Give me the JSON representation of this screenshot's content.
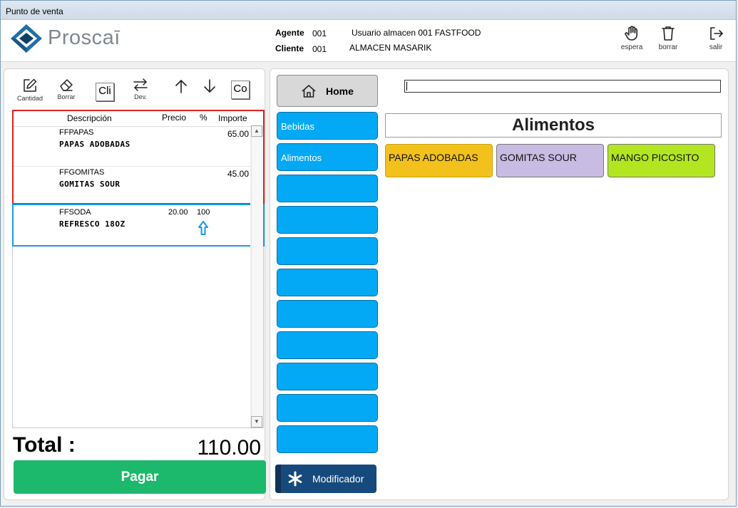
{
  "window": {
    "title": "Punto de venta"
  },
  "header": {
    "logo_text": "Proscaī",
    "agente_label": "Agente",
    "agente_code": "001",
    "agente_name": "Usuario almacen 001 FASTFOOD",
    "cliente_label": "Cliente",
    "cliente_code": "001",
    "cliente_name": "ALMACEN MASARIK",
    "actions": [
      {
        "label": "espera",
        "icon": "hand-icon"
      },
      {
        "label": "borrar",
        "icon": "trash-icon"
      },
      {
        "label": "salir",
        "icon": "logout-icon"
      }
    ]
  },
  "toolbar": {
    "cantidad_label": "Cantidad",
    "borrar_label": "Borrar",
    "cli_label": "Cli",
    "dev_label": "Dev.",
    "co_label": "Co"
  },
  "grid": {
    "columns": {
      "descripcion": "Descripción",
      "precio": "Precio",
      "pct": "%",
      "importe": "Importe"
    },
    "rows": [
      {
        "code": "FFPAPAS",
        "name": "PAPAS ADOBADAS",
        "precio": "",
        "pct": "",
        "importe": "65.00"
      },
      {
        "code": "FFGOMITAS",
        "name": "GOMITAS SOUR",
        "precio": "",
        "pct": "",
        "importe": "45.00"
      },
      {
        "code": "FFSODA",
        "name": "REFRESCO 18OZ",
        "precio": "20.00",
        "pct": "100",
        "importe": ""
      }
    ]
  },
  "total": {
    "label": "Total :",
    "value": "110.00"
  },
  "pay_label": "Pagar",
  "nav": {
    "home_label": "Home",
    "categories": [
      "Bebidas",
      "Alimentos",
      "",
      "",
      "",
      "",
      "",
      "",
      "",
      "",
      ""
    ],
    "modificador_label": "Modificador"
  },
  "search": {
    "value": ""
  },
  "category_title": "Alimentos",
  "products": [
    {
      "name": "PAPAS ADOBADAS",
      "color": "#f2c11c"
    },
    {
      "name": "GOMITAS SOUR",
      "color": "#c8bce3"
    },
    {
      "name": "MANGO PICOSITO",
      "color": "#b3e620"
    }
  ],
  "colors": {
    "accent_blue": "#03a9f4",
    "pay_green": "#1cb86b",
    "highlight_red": "#e02020",
    "highlight_blue": "#1a9be0",
    "mod_navy": "#174a7c"
  }
}
